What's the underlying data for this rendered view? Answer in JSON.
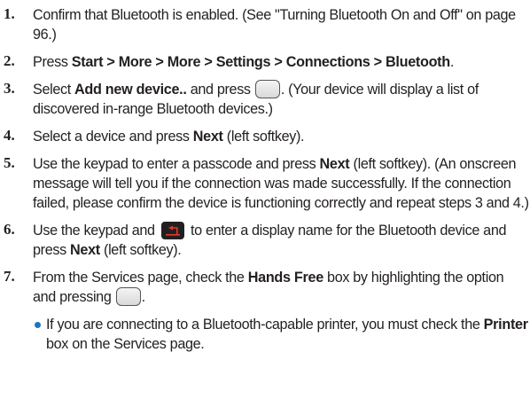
{
  "steps": [
    {
      "n": "1.",
      "parts": [
        {
          "t": "Confirm that Bluetooth is enabled. (See \"Turning Bluetooth On and Off\" on page 96.)"
        }
      ]
    },
    {
      "n": "2.",
      "parts": [
        {
          "t": "Press "
        },
        {
          "b": "Start > More > More > Settings > Connections > Bluetooth"
        },
        {
          "t": "."
        }
      ]
    },
    {
      "n": "3.",
      "parts": [
        {
          "t": "Select "
        },
        {
          "b": "Add new device.."
        },
        {
          "t": " and press "
        },
        {
          "icon": "ok-key-icon"
        },
        {
          "t": ". (Your device will display a list of discovered in-range Bluetooth devices.)"
        }
      ]
    },
    {
      "n": "4.",
      "parts": [
        {
          "t": "Select a device and press "
        },
        {
          "b": "Next"
        },
        {
          "t": " (left softkey)."
        }
      ]
    },
    {
      "n": "5.",
      "parts": [
        {
          "t": "Use the keypad to enter a passcode and press "
        },
        {
          "b": "Next"
        },
        {
          "t": " (left softkey). (An onscreen message will tell you if the connection was made successfully. If the connection failed, please confirm the device is functioning correctly and repeat steps 3 and 4.)"
        }
      ]
    },
    {
      "n": "6.",
      "parts": [
        {
          "t": "Use the keypad and "
        },
        {
          "icon": "back-key-icon"
        },
        {
          "t": " to enter a display name for the Bluetooth device and press "
        },
        {
          "b": "Next"
        },
        {
          "t": " (left softkey)."
        }
      ]
    },
    {
      "n": "7.",
      "parts": [
        {
          "t": "From the Services page, check the "
        },
        {
          "b": "Hands Free"
        },
        {
          "t": " box by highlighting the option and pressing "
        },
        {
          "icon": "ok-key-icon"
        },
        {
          "t": "."
        }
      ],
      "sub": [
        {
          "t": "If you are connecting to a Bluetooth-capable printer, you must check the "
        },
        {
          "b": "Printer"
        },
        {
          "t": " box on the Services page."
        }
      ]
    }
  ]
}
